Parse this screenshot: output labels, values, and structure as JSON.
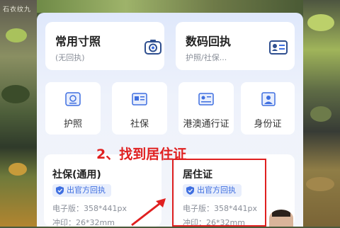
{
  "background": {
    "title": "石衣纹九"
  },
  "top_cards": [
    {
      "title": "常用寸照",
      "subtitle": "(无回执)",
      "icon": "camera-icon"
    },
    {
      "title": "数码回执",
      "subtitle": "护照/社保...",
      "icon": "id-card-icon"
    }
  ],
  "doc_types": [
    {
      "label": "护照",
      "icon": "passport-icon"
    },
    {
      "label": "社保",
      "icon": "social-security-card-icon"
    },
    {
      "label": "港澳通行证",
      "icon": "travel-permit-icon"
    },
    {
      "label": "身份证",
      "icon": "id-photo-icon"
    }
  ],
  "annotation": {
    "text": "2、找到居住证",
    "color": "#e02020"
  },
  "bottom_cards": [
    {
      "title": "社保(通用)",
      "badge": "出官方回执",
      "size_line": "电子版：358*441px",
      "print_line": "冲印：26*32mm"
    },
    {
      "title": "居住证",
      "badge": "出官方回执",
      "size_line": "电子版：358*441px",
      "print_line": "冲印：26*32mm"
    }
  ],
  "colors": {
    "accent": "#3f6fe0",
    "highlight": "#e02020",
    "panel_bg": "#eef2fb"
  }
}
